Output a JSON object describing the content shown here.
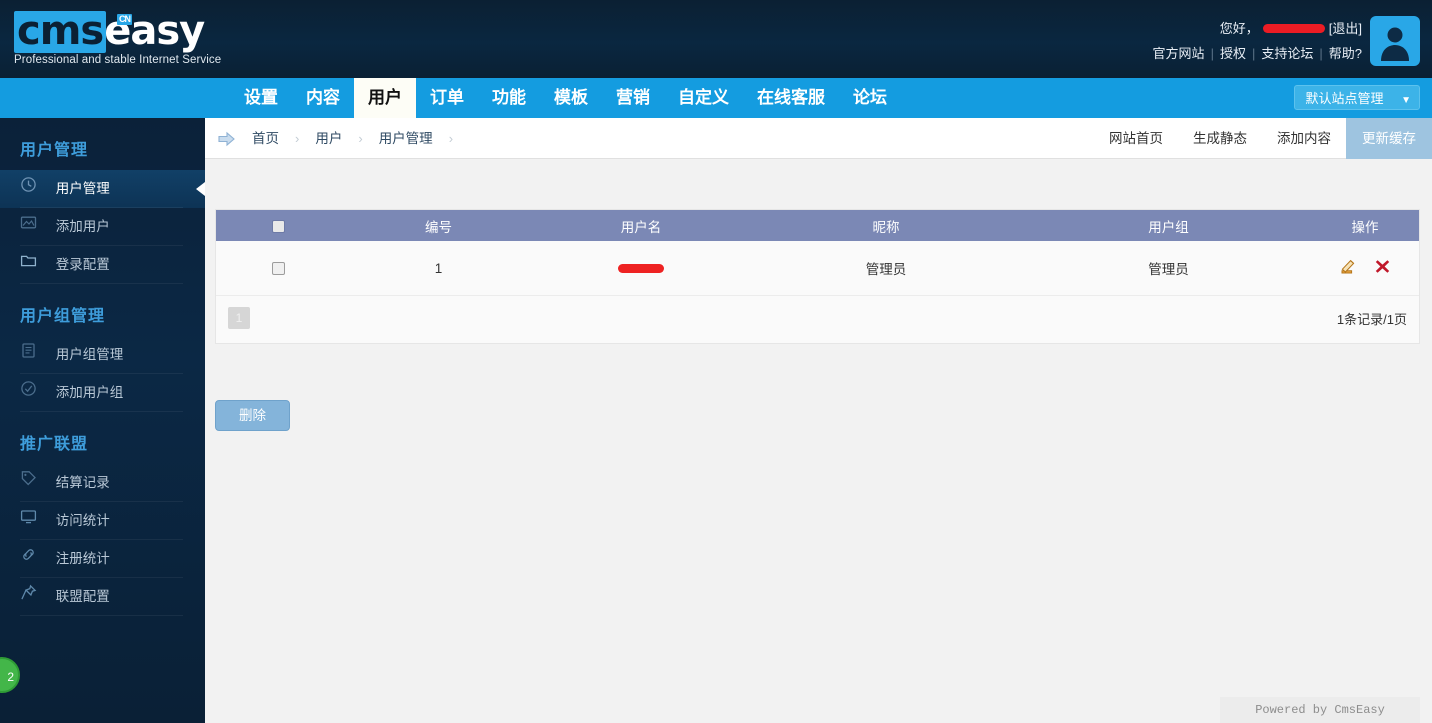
{
  "header": {
    "logo_cms": "cms",
    "logo_easy": "easy",
    "logo_cn": "CN",
    "logo_tagline": "Professional and stable Internet Service",
    "greeting": "您好，",
    "username_redacted": "",
    "logout": "[退出]",
    "links": [
      {
        "label": "官方网站"
      },
      {
        "label": "授权"
      },
      {
        "label": "支持论坛"
      },
      {
        "label": "帮助?"
      }
    ],
    "avatar_alt": "user-avatar"
  },
  "nav": {
    "items": [
      {
        "label": "设置",
        "active": false
      },
      {
        "label": "内容",
        "active": false
      },
      {
        "label": "用户",
        "active": true
      },
      {
        "label": "订单",
        "active": false
      },
      {
        "label": "功能",
        "active": false
      },
      {
        "label": "模板",
        "active": false
      },
      {
        "label": "营销",
        "active": false
      },
      {
        "label": "自定义",
        "active": false
      },
      {
        "label": "在线客服",
        "active": false
      },
      {
        "label": "论坛",
        "active": false
      }
    ],
    "site_select": "默认站点管理",
    "site_caret": "▼"
  },
  "sidebar": {
    "sections": [
      {
        "title": "用户管理",
        "items": [
          {
            "label": "用户管理",
            "icon": "clock-icon",
            "active": true
          },
          {
            "label": "添加用户",
            "icon": "image-icon",
            "active": false
          },
          {
            "label": "登录配置",
            "icon": "folder-icon",
            "active": false
          }
        ]
      },
      {
        "title": "用户组管理",
        "items": [
          {
            "label": "用户组管理",
            "icon": "document-icon",
            "active": false
          },
          {
            "label": "添加用户组",
            "icon": "check-circle-icon",
            "active": false
          }
        ]
      },
      {
        "title": "推广联盟",
        "items": [
          {
            "label": "结算记录",
            "icon": "tag-icon",
            "active": false
          },
          {
            "label": "访问统计",
            "icon": "monitor-icon",
            "active": false
          },
          {
            "label": "注册统计",
            "icon": "link-icon",
            "active": false
          },
          {
            "label": "联盟配置",
            "icon": "pin-icon",
            "active": false
          }
        ]
      }
    ],
    "badge": "2"
  },
  "breadcrumb": {
    "arrow_icon": "arrow-right-icon",
    "items": [
      {
        "label": "首页"
      },
      {
        "label": "用户"
      },
      {
        "label": "用户管理"
      }
    ],
    "separator": "›",
    "actions": [
      {
        "label": "网站首页",
        "highlight": false
      },
      {
        "label": "生成静态",
        "highlight": false
      },
      {
        "label": "添加内容",
        "highlight": false
      },
      {
        "label": "更新缓存",
        "highlight": true
      }
    ]
  },
  "table": {
    "columns": [
      "",
      "编号",
      "用户名",
      "昵称",
      "用户组",
      "操作"
    ],
    "rows": [
      {
        "id": "1",
        "username_redacted": "",
        "nickname": "管理员",
        "group": "管理员",
        "actions": [
          "edit-icon",
          "delete-icon"
        ]
      }
    ]
  },
  "pager": {
    "current_page": "1",
    "summary": "1条记录/1页"
  },
  "buttons": {
    "delete": "删除"
  },
  "footer": {
    "powered_by": "Powered by CmsEasy"
  },
  "colors": {
    "header_bg": "#0a2239",
    "nav_bg": "#149ce0",
    "accent": "#29a7e7",
    "table_head": "#7b88b5",
    "btn_blue": "#84b4da",
    "highlight": "#9ec4e0",
    "badge_green": "#43b649",
    "redact_red": "#ee2222"
  }
}
